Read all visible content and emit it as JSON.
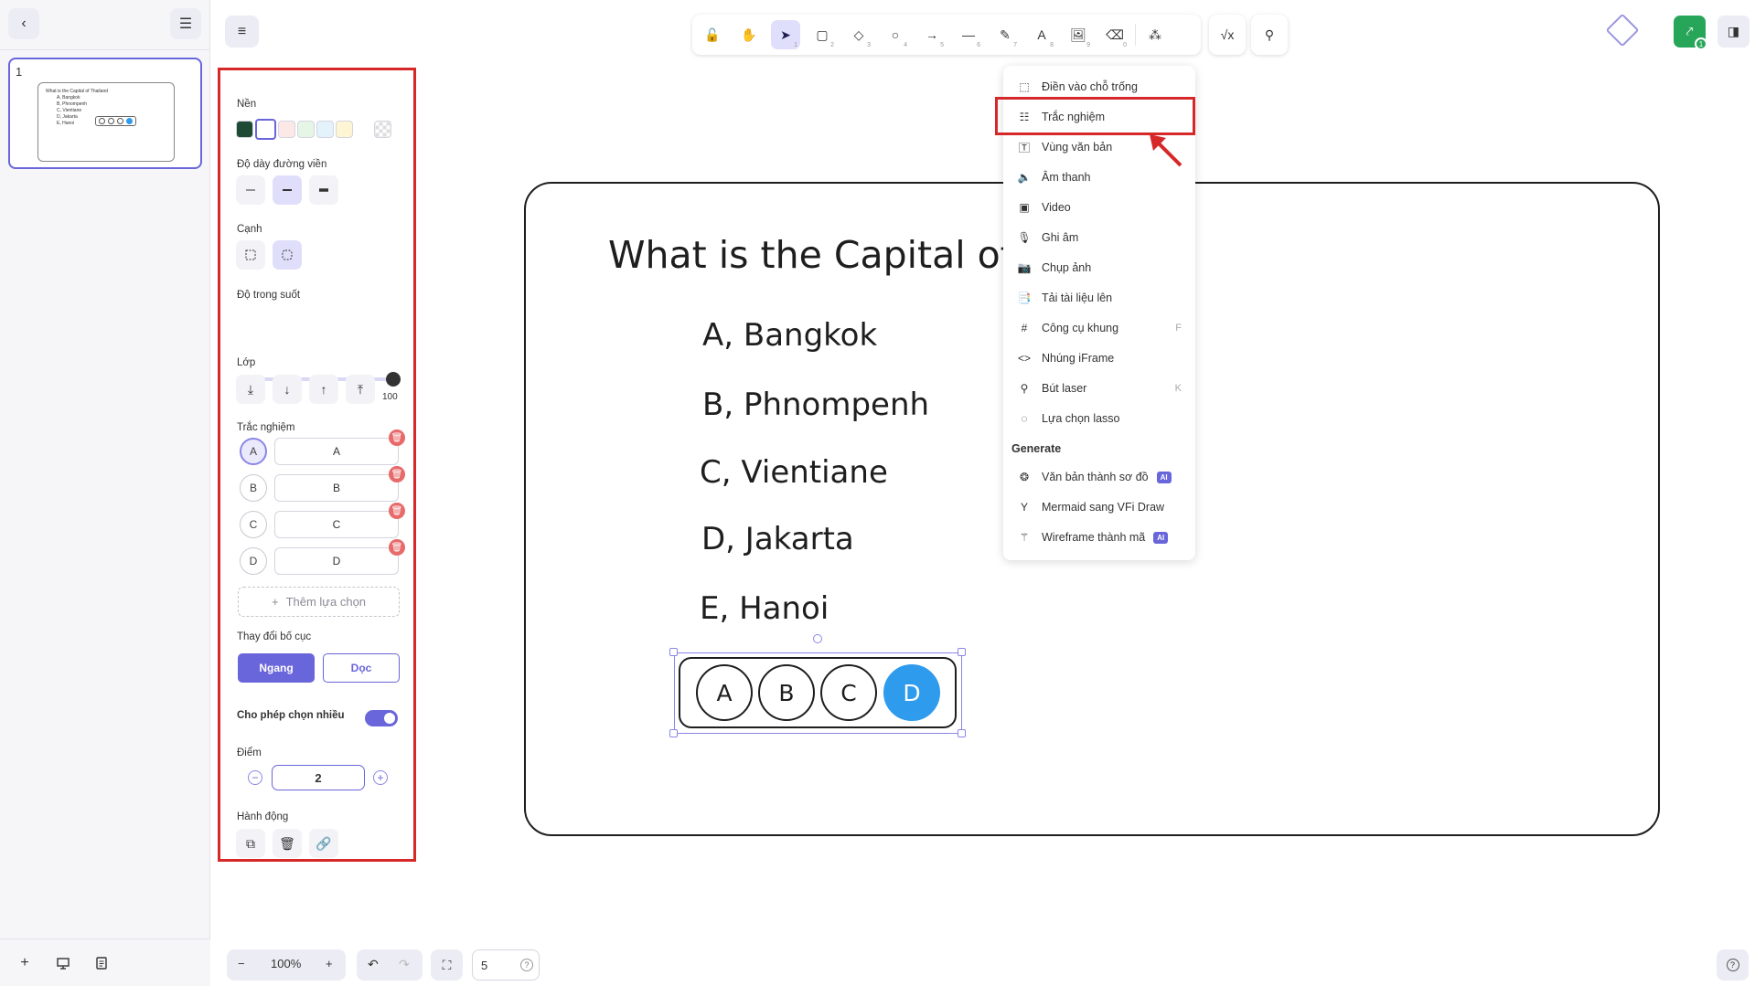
{
  "slides": {
    "current_number": "1",
    "thumb_title": "What is the Capital of Thailand",
    "thumb_options": [
      "A, Bangkok",
      "B, Phnompenh",
      "C, Vientiane",
      "D, Jakarta",
      "E, Hanoi"
    ]
  },
  "properties": {
    "background_label": "Nền",
    "background_colors": [
      "#1f4a33",
      "#ffffff",
      "#fde8e8",
      "#e6f6e6",
      "#e3f2fb",
      "#fdf5d4"
    ],
    "stroke_width_label": "Độ dày đường viền",
    "edges_label": "Cạnh",
    "opacity_label": "Độ trong suốt",
    "opacity_min": "0",
    "opacity_max": "100",
    "opacity_value": 100,
    "layers_label": "Lớp",
    "quiz_label": "Trắc nghiệm",
    "choices": [
      {
        "letter": "A",
        "value": "A"
      },
      {
        "letter": "B",
        "value": "B"
      },
      {
        "letter": "C",
        "value": "C"
      },
      {
        "letter": "D",
        "value": "D"
      }
    ],
    "add_choice_label": "Thêm lựa chọn",
    "change_layout_label": "Thay đổi bố cục",
    "layout_horizontal": "Ngang",
    "layout_vertical": "Dọc",
    "allow_multi_label": "Cho phép chọn nhiều",
    "allow_multi_on": true,
    "score_label": "Điểm",
    "score_value": "2",
    "actions_label": "Hành động"
  },
  "canvas": {
    "question": "What is the Capital of",
    "answers": [
      "A, Bangkok",
      "B, Phnompenh",
      "C, Vientiane",
      "D, Jakarta",
      "E, Hanoi"
    ],
    "mc_options": [
      "A",
      "B",
      "C",
      "D"
    ],
    "mc_selected": "D"
  },
  "menu": {
    "items": [
      {
        "icon": "dashed-box-icon",
        "label": "Điền vào chỗ trống"
      },
      {
        "icon": "list-icon",
        "label": "Trắc nghiệm"
      },
      {
        "icon": "text-box-icon",
        "label": "Vùng văn bản"
      },
      {
        "icon": "speaker-icon",
        "label": "Âm thanh"
      },
      {
        "icon": "video-icon",
        "label": "Video"
      },
      {
        "icon": "mic-icon",
        "label": "Ghi âm"
      },
      {
        "icon": "camera-icon",
        "label": "Chụp ảnh"
      },
      {
        "icon": "upload-doc-icon",
        "label": "Tải tài liệu lên"
      },
      {
        "icon": "frame-icon",
        "label": "Công cụ khung",
        "shortcut": "F"
      },
      {
        "icon": "code-icon",
        "label": "Nhúng iFrame"
      },
      {
        "icon": "laser-icon",
        "label": "Bút laser",
        "shortcut": "K"
      },
      {
        "icon": "lasso-icon",
        "label": "Lựa chọn lasso"
      }
    ],
    "generate_label": "Generate",
    "generate_items": [
      {
        "icon": "brain-icon",
        "label": "Văn bản thành sơ đồ",
        "badge": "AI"
      },
      {
        "icon": "mermaid-icon",
        "label": "Mermaid sang VFi Draw"
      },
      {
        "icon": "wand-icon",
        "label": "Wireframe thành mã",
        "badge": "AI"
      }
    ]
  },
  "toolbar": {
    "shortcuts": [
      "1",
      "2",
      "3",
      "4",
      "5",
      "6",
      "7",
      "8",
      "9",
      "0"
    ]
  },
  "share_count": "1",
  "bottom": {
    "zoom_level": "100%",
    "page_value": "5"
  },
  "colors": {
    "accent": "#6965db",
    "highlight": "#d62828",
    "selected_option": "#2f9bed",
    "share_green": "#27a65a"
  }
}
